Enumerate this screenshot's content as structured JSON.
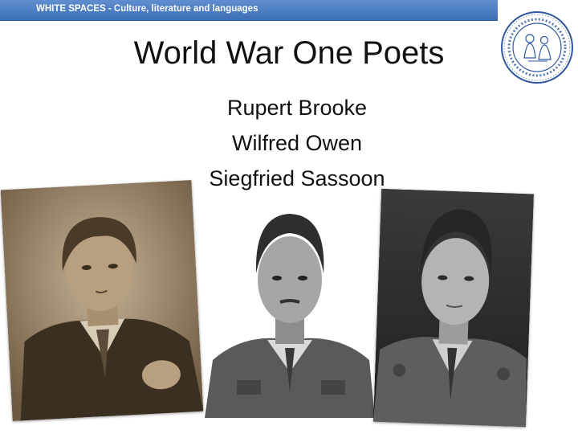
{
  "header": {
    "subtitle": "WHITE SPACES - Culture, literature and languages",
    "accent_color": "#3e6fb6"
  },
  "seal": {
    "icon": "university-seal-icon",
    "text_ring": "UNIVERSITATIS · STUDIORUM · SIGILLUM"
  },
  "slide": {
    "title": "World War One Poets",
    "poets": [
      "Rupert Brooke",
      "Wilfred Owen",
      "Siegfried Sassoon"
    ]
  },
  "photos": [
    {
      "subject": "Rupert Brooke",
      "tone": "sepia"
    },
    {
      "subject": "Wilfred Owen",
      "tone": "grayscale"
    },
    {
      "subject": "Siegfried Sassoon",
      "tone": "grayscale"
    }
  ]
}
